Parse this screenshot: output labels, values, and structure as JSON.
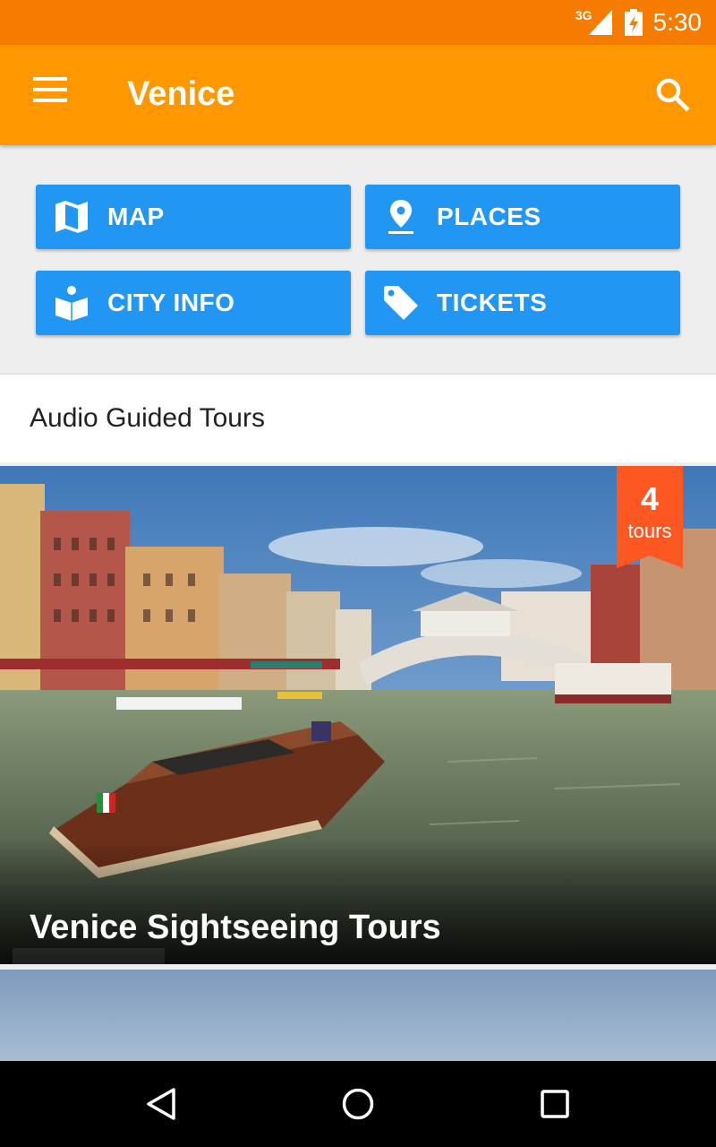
{
  "status_bar": {
    "network": "3G",
    "time": "5:30",
    "icons": [
      "signal-icon",
      "battery-charging-icon"
    ]
  },
  "app_bar": {
    "title": "Venice",
    "menu_icon": "menu-icon",
    "search_icon": "search-icon",
    "color": "#ff9800"
  },
  "actions": [
    {
      "label": "MAP",
      "icon": "map-icon"
    },
    {
      "label": "PLACES",
      "icon": "place-pin-icon"
    },
    {
      "label": "CITY INFO",
      "icon": "city-info-icon"
    },
    {
      "label": "TICKETS",
      "icon": "ticket-tag-icon"
    }
  ],
  "action_color": "#2196f3",
  "section": {
    "title": "Audio Guided Tours"
  },
  "tours": [
    {
      "title": "Venice Sightseeing Tours",
      "count": "4",
      "count_unit": "tours",
      "badge_color": "#ff5722"
    }
  ],
  "nav_bar": {
    "icons": [
      "back-icon",
      "home-icon",
      "recent-apps-icon"
    ]
  }
}
